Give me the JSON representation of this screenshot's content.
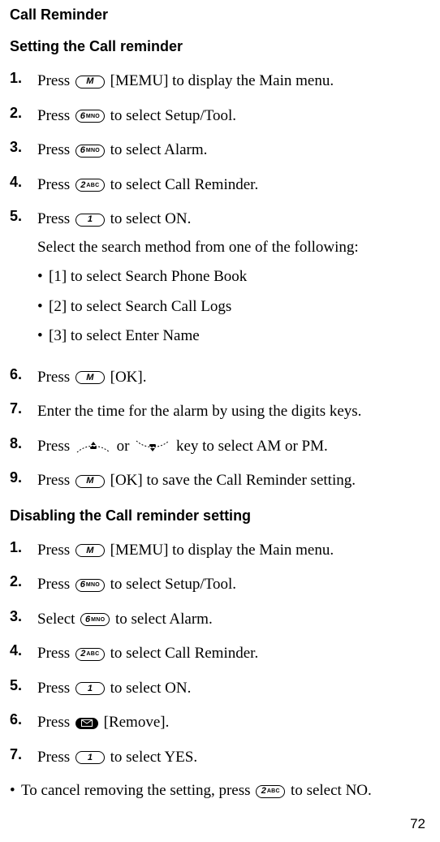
{
  "heading": "Call Reminder",
  "section1": {
    "heading": "Setting the Call reminder",
    "steps": [
      {
        "num": "1.",
        "pre": "Press ",
        "key": "M",
        "post": " [MEMU] to display the Main menu."
      },
      {
        "num": "2.",
        "pre": "Press ",
        "key": "6MNO",
        "post": " to select Setup/Tool."
      },
      {
        "num": "3.",
        "pre": "Press ",
        "key": "6MNO",
        "post": " to select Alarm."
      },
      {
        "num": "4.",
        "pre": "Press ",
        "key": "2ABC",
        "post": " to select Call Reminder."
      },
      {
        "num": "5.",
        "pre": "Press ",
        "key": "1",
        "post": " to select ON.",
        "extra": "Select the search method from one of the following:",
        "bullets": [
          "[1] to select Search Phone Book",
          "[2] to select Search Call Logs",
          "[3] to select Enter Name"
        ]
      },
      {
        "num": "6.",
        "pre": "Press ",
        "key": "M",
        "post": " [OK]."
      },
      {
        "num": "7.",
        "full": "Enter the time for the alarm by using the digits keys."
      },
      {
        "num": "8.",
        "pre": "Press ",
        "key": "UP",
        "mid": " or ",
        "key2": "DOWN",
        "post": " key to select AM or PM."
      },
      {
        "num": "9.",
        "pre": "Press ",
        "key": "M",
        "post": " [OK] to save the Call Reminder setting."
      }
    ]
  },
  "section2": {
    "heading": "Disabling the Call reminder setting",
    "steps": [
      {
        "num": "1.",
        "pre": "Press ",
        "key": "M",
        "post": " [MEMU] to display the Main menu."
      },
      {
        "num": "2.",
        "pre": "Press ",
        "key": "6MNO",
        "post": " to select Setup/Tool."
      },
      {
        "num": "3.",
        "pre": "Select ",
        "key": "6MNO",
        "post": " to select Alarm."
      },
      {
        "num": "4.",
        "pre": "Press ",
        "key": "2ABC",
        "post": " to select Call Reminder."
      },
      {
        "num": "5.",
        "pre": "Press ",
        "key": "1",
        "post": " to select ON."
      },
      {
        "num": "6.",
        "pre": "Press ",
        "key": "MAIL",
        "post": " [Remove]."
      },
      {
        "num": "7.",
        "pre": "Press ",
        "key": "1",
        "post": " to select YES."
      }
    ],
    "note": {
      "pre": "To cancel removing the setting, press ",
      "key": "2ABC",
      "post": " to select NO."
    }
  },
  "pageNumber": "72",
  "keys": {
    "M": {
      "digit": "M",
      "letters": ""
    },
    "6MNO": {
      "digit": "6",
      "letters": "MNO"
    },
    "2ABC": {
      "digit": "2",
      "letters": "ABC"
    },
    "1": {
      "digit": "1",
      "letters": ""
    }
  }
}
